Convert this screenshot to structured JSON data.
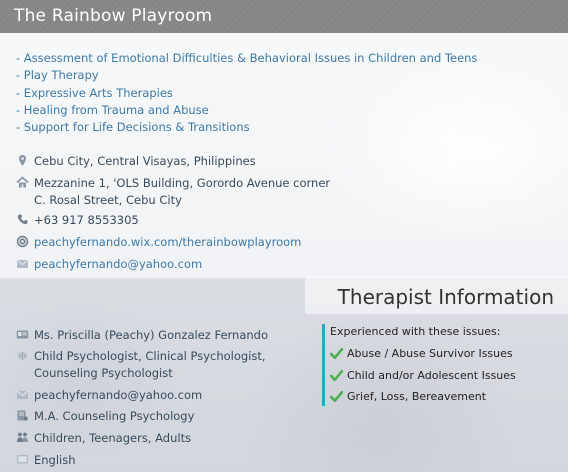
{
  "header": {
    "title": "The Rainbow Playroom"
  },
  "services": [
    "- Assessment of Emotional Difficulties & Behavioral Issues in Children and Teens",
    "- Play Therapy",
    "- Expressive Arts Therapies",
    "- Healing from Trauma and Abuse",
    "- Support for Life Decisions & Transitions"
  ],
  "contact": {
    "location": "Cebu City, Central Visayas, Philippines",
    "address_line1": "Mezzanine 1, 'OLS Building, Gorordo Avenue corner",
    "address_line2": "C. Rosal Street, Cebu City",
    "phone": "+63 917 8553305",
    "website": "peachyfernando.wix.com/therainbowplayroom",
    "email": "peachyfernando@yahoo.com"
  },
  "therapist": {
    "section_title": "Therapist Information",
    "name": "Ms. Priscilla (Peachy) Gonzalez Fernando",
    "title_line1": "Child Psychologist, Clinical Psychologist,",
    "title_line2": "Counseling Psychologist",
    "email": "peachyfernando@yahoo.com",
    "degree": "M.A. Counseling Psychology",
    "ages": "Children, Teenagers, Adults",
    "language": "English",
    "issues_heading": "Experienced with these issues:",
    "issues": [
      "Abuse / Abuse Survivor Issues",
      "Child and/or Adolescent Issues",
      "Grief, Loss, Bereavement"
    ]
  },
  "colors": {
    "title_bar": "#888888",
    "link": "#3d7aa8",
    "accent_bar": "#2aa6c8",
    "check": "#4caf50"
  },
  "icons": {
    "location": "map-pin-icon",
    "address": "house-icon",
    "phone": "phone-icon",
    "website": "web-icon",
    "email": "email-icon",
    "name": "id-card-icon",
    "title": "brain-icon",
    "therapist_email": "email-icon",
    "degree": "diploma-icon",
    "ages": "people-icon",
    "language": "speech-icon",
    "issue": "check-icon"
  }
}
